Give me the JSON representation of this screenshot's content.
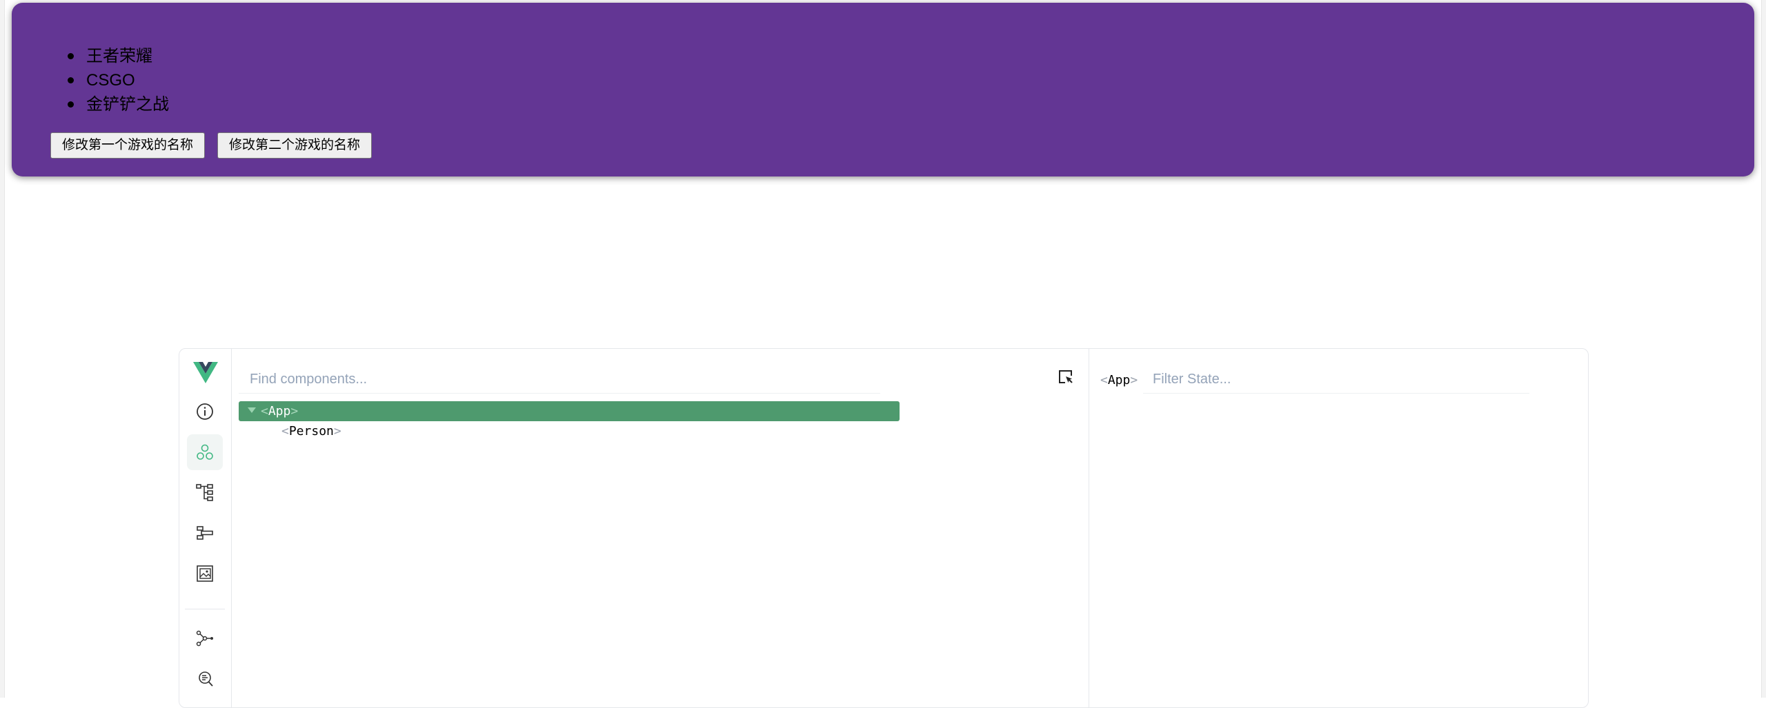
{
  "app": {
    "games": [
      "王者荣耀",
      "CSGO",
      "金铲铲之战"
    ],
    "buttons": {
      "change_first": "修改第一个游戏的名称",
      "change_second": "修改第二个游戏的名称"
    },
    "card_color": "#633694"
  },
  "devtools": {
    "search": {
      "placeholder": "Find components..."
    },
    "tree": [
      {
        "name": "App",
        "selected": true
      },
      {
        "name": "Person",
        "selected": false
      }
    ],
    "state": {
      "selected_component": "App",
      "filter_placeholder": "Filter State..."
    },
    "sidebar_icons": [
      "vue-logo-icon",
      "info-icon",
      "components-icon",
      "component-tree-icon",
      "timeline-icon",
      "assets-icon",
      "router-graph-icon",
      "inspector-search-icon"
    ],
    "accent_color": "#4e9a6e"
  }
}
